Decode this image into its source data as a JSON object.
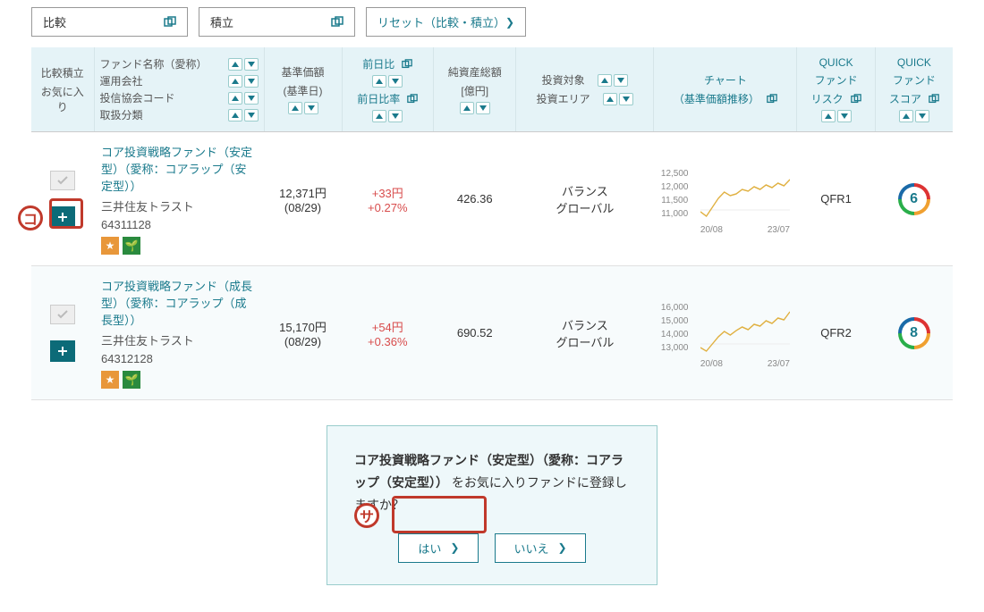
{
  "top_buttons": {
    "compare": "比較",
    "accumulate": "積立",
    "reset": "リセット（比較・積立）"
  },
  "headers": {
    "compare_label": "比較積立",
    "favorite_label": "お気に入り",
    "fund_lines": {
      "l1": "ファンド名称（愛称）",
      "l2": "運用会社",
      "l3": "投信協会コード",
      "l4": "取扱分類"
    },
    "nav": "基準価額",
    "nav_sub": "(基準日)",
    "change": "前日比",
    "change_rate": "前日比率",
    "assets": "純資産総額",
    "assets_unit": "[億円]",
    "inv_target": "投資対象",
    "inv_area": "投資エリア",
    "chart": "チャート",
    "chart_sub": "（基準価額推移）",
    "quick_risk": "QUICK",
    "quick_risk2": "ファンド",
    "quick_risk3": "リスク",
    "quick_score": "QUICK",
    "quick_score2": "ファンド",
    "quick_score3": "スコア"
  },
  "rows": [
    {
      "name": "コア投資戦略ファンド（安定型）（愛称：コアラップ（安定型））",
      "company": "三井住友トラスト",
      "code": "64311128",
      "nav": "12,371円",
      "nav_date": "(08/29)",
      "change": "+33円",
      "change_rate": "+0.27%",
      "assets": "426.36",
      "inv_target": "バランス",
      "inv_area": "グローバル",
      "chart_y": [
        "12,500",
        "12,000",
        "11,500",
        "11,000"
      ],
      "chart_x": [
        "20/08",
        "23/07"
      ],
      "risk": "QFR1",
      "score": "6"
    },
    {
      "name": "コア投資戦略ファンド（成長型）（愛称：コアラップ（成長型））",
      "company": "三井住友トラスト",
      "code": "64312128",
      "nav": "15,170円",
      "nav_date": "(08/29)",
      "change": "+54円",
      "change_rate": "+0.36%",
      "assets": "690.52",
      "inv_target": "バランス",
      "inv_area": "グローバル",
      "chart_y": [
        "16,000",
        "15,000",
        "14,000",
        "13,000"
      ],
      "chart_x": [
        "20/08",
        "23/07"
      ],
      "risk": "QFR2",
      "score": "8"
    }
  ],
  "dialog": {
    "fund_name": "コア投資戦略ファンド（安定型）（愛称：コアラップ（安定型））",
    "suffix": "をお気に入りファンドに登録しますか？",
    "yes": "はい",
    "no": "いいえ"
  },
  "annotations": {
    "ko": "コ",
    "sa": "サ"
  },
  "chart_data": [
    {
      "type": "line",
      "title": "基準価額推移 (row 1)",
      "xlabel": "",
      "ylabel": "",
      "x_range": [
        "20/08",
        "23/07"
      ],
      "ylim": [
        11000,
        12500
      ],
      "y_ticks": [
        11000,
        11500,
        12000,
        12500
      ],
      "series": [
        {
          "name": "基準価額",
          "values": [
            11200,
            11000,
            11400,
            11800,
            12100,
            11900,
            12000,
            12200,
            12100,
            12300,
            12200,
            12400
          ]
        }
      ]
    },
    {
      "type": "line",
      "title": "基準価額推移 (row 2)",
      "xlabel": "",
      "ylabel": "",
      "x_range": [
        "20/08",
        "23/07"
      ],
      "ylim": [
        13000,
        16000
      ],
      "y_ticks": [
        13000,
        14000,
        15000,
        16000
      ],
      "series": [
        {
          "name": "基準価額",
          "values": [
            13200,
            12900,
            13400,
            13900,
            14200,
            14000,
            14300,
            14600,
            14400,
            14800,
            14900,
            15200
          ]
        }
      ]
    }
  ]
}
